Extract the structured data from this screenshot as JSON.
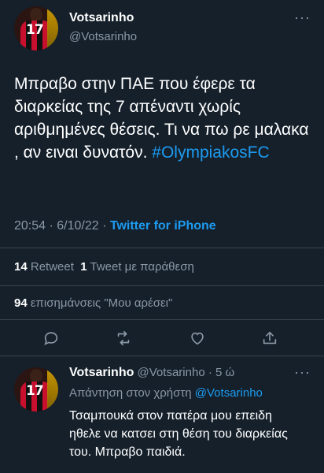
{
  "tweet": {
    "author_name": "Votsarinho",
    "author_handle": "@Votsarinho",
    "more_icon": "···",
    "avatar_number": "17",
    "text": "Μπραβο στην ΠΑΕ που έφερε τα διαρκείας της 7 απέναντι χωρίς αριθμημένες θέσεις. Τι να πω ρε μαλακα , αν ειναι δυνατόν.",
    "hashtag": "#OlympiakosFC",
    "time": "20:54 · 6/10/22 · ",
    "source": "Twitter for iPhone",
    "retweets_count": "14",
    "retweets_label": "Retweet",
    "quotes_count": "1",
    "quotes_label": "Tweet με παράθεση",
    "likes_count": "94",
    "likes_label": "επισημάνσεις \"Μου αρέσει\""
  },
  "actions": {
    "reply_icon": "comment-icon",
    "retweet_icon": "retweet-icon",
    "like_icon": "heart-icon",
    "share_icon": "share-icon"
  },
  "reply": {
    "author_name": "Votsarinho",
    "author_handle": "@Votsarinho",
    "time": "· 5 ώ",
    "more_icon": "···",
    "avatar_number": "17",
    "replying_to_label": "Απάντηση στον χρήστη",
    "replying_to_handle": "@Votsarinho",
    "text": "Τσαμπουκά στον πατέρα μου επειδη ηθελε να κατσει στη θέση του διαρκείας του. Μπραβο παιδιά."
  },
  "colors": {
    "background": "#15202b",
    "accent": "#1d9bf0",
    "secondary_text": "#8b98a5",
    "divider": "#38444d"
  }
}
